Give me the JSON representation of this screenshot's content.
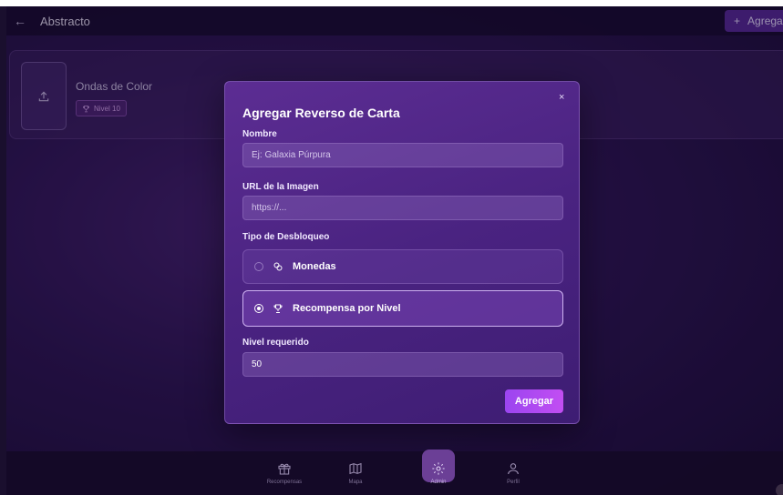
{
  "header": {
    "title": "Abstracto",
    "add_label": "Agrega"
  },
  "card_list": {
    "items": [
      {
        "name": "Ondas de Color",
        "badge": "Nivel 10"
      }
    ]
  },
  "modal": {
    "title": "Agregar Reverso de Carta",
    "close_glyph": "×",
    "fields": {
      "name_label": "Nombre",
      "name_placeholder": "Ej: Galaxia Púrpura",
      "url_label": "URL de la Imagen",
      "url_placeholder": "https://...",
      "unlock_label": "Tipo de Desbloqueo",
      "level_label": "Nivel requerido",
      "level_value": "50"
    },
    "unlock_options": [
      {
        "label": "Monedas",
        "icon": "coins-icon",
        "selected": false
      },
      {
        "label": "Recompensa por Nivel",
        "icon": "trophy-icon",
        "selected": true
      }
    ],
    "submit_label": "Agregar"
  },
  "bottom_nav": {
    "items": [
      {
        "label": "Recompensas",
        "icon": "gift-icon",
        "active": false
      },
      {
        "label": "Mapa",
        "icon": "map-icon",
        "active": false
      },
      {
        "label": "Admin",
        "icon": "gear-icon",
        "active": true
      },
      {
        "label": "Perfil",
        "icon": "user-icon",
        "active": false
      }
    ]
  },
  "colors": {
    "accent": "#9b45f0",
    "modal_bg": "#4a2381",
    "background": "#2f1656"
  }
}
